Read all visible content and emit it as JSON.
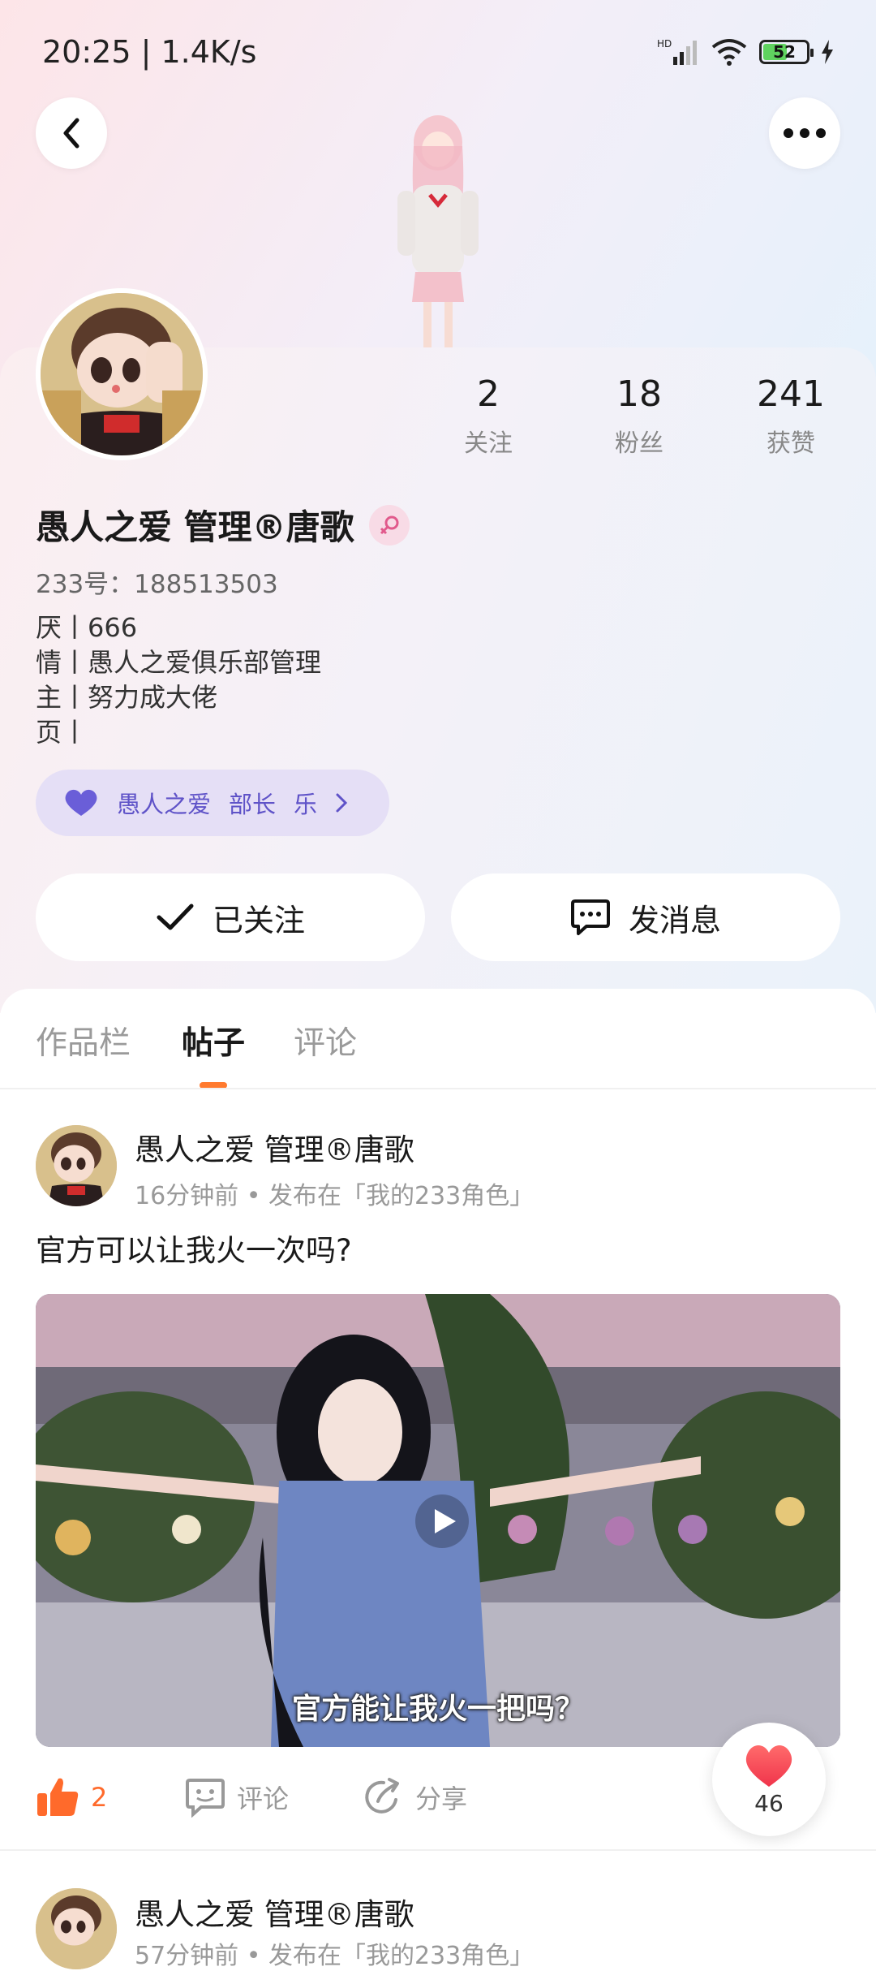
{
  "status_bar": {
    "time": "20:25 | 1.4K/s",
    "battery": "52"
  },
  "profile": {
    "stats": [
      {
        "num": "2",
        "label": "关注"
      },
      {
        "num": "18",
        "label": "粉丝"
      },
      {
        "num": "241",
        "label": "获赞"
      }
    ],
    "name": "愚人之爱 管理®唐歌",
    "uid": "233号：188513503",
    "bio": [
      "厌丨666",
      "情丨愚人之爱俱乐部管理",
      "主丨努力成大佬",
      "页丨"
    ],
    "club": {
      "name": "愚人之爱",
      "role": "部长",
      "tag": "乐"
    },
    "follow_button": "已关注",
    "message_button": "发消息"
  },
  "tabs": [
    "作品栏",
    "帖子",
    "评论"
  ],
  "posts": [
    {
      "author": "愚人之爱 管理®唐歌",
      "meta": "16分钟前 • 发布在「我的233角色」",
      "text": "官方可以让我火一次吗?",
      "video_caption": "官方能让我火一把吗？",
      "likes": "2",
      "comment_label": "评论",
      "share_label": "分享",
      "hearts": "46"
    },
    {
      "author": "愚人之爱 管理®唐歌",
      "meta": "57分钟前 • 发布在「我的233角色」"
    }
  ],
  "colors": {
    "accent": "#ff7a2e",
    "badge_bg": "#e5dff6",
    "badge_text": "#5f53c8"
  }
}
